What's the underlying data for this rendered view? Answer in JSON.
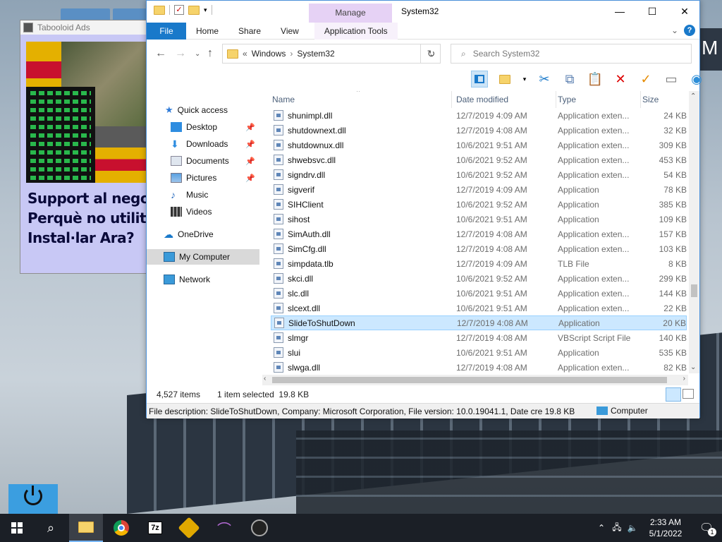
{
  "ads": {
    "title": "Tabooloid Ads",
    "lines": [
      "Support al negoci",
      "Perquè no utilitza",
      "Instal·lar Ara?"
    ]
  },
  "explorer": {
    "title": "System32",
    "manage_tab": "Manage",
    "ribbon_tabs": [
      "File",
      "Home",
      "Share",
      "View",
      "Application Tools"
    ],
    "address": {
      "prefix": "«",
      "crumbs": [
        "Windows",
        "System32"
      ]
    },
    "search_placeholder": "Search System32",
    "nav": {
      "quick_access": "Quick access",
      "items": [
        "Desktop",
        "Downloads",
        "Documents",
        "Pictures",
        "Music",
        "Videos"
      ],
      "onedrive": "OneDrive",
      "my_computer": "My Computer",
      "network": "Network"
    },
    "columns": [
      "Name",
      "Date modified",
      "Type",
      "Size"
    ],
    "files": [
      {
        "name": "shunimpl.dll",
        "date": "12/7/2019 4:09 AM",
        "type": "Application exten...",
        "size": "24 KB"
      },
      {
        "name": "shutdownext.dll",
        "date": "12/7/2019 4:08 AM",
        "type": "Application exten...",
        "size": "32 KB"
      },
      {
        "name": "shutdownux.dll",
        "date": "10/6/2021 9:51 AM",
        "type": "Application exten...",
        "size": "309 KB"
      },
      {
        "name": "shwebsvc.dll",
        "date": "10/6/2021 9:52 AM",
        "type": "Application exten...",
        "size": "453 KB"
      },
      {
        "name": "signdrv.dll",
        "date": "10/6/2021 9:52 AM",
        "type": "Application exten...",
        "size": "54 KB"
      },
      {
        "name": "sigverif",
        "date": "12/7/2019 4:09 AM",
        "type": "Application",
        "size": "78 KB"
      },
      {
        "name": "SIHClient",
        "date": "10/6/2021 9:52 AM",
        "type": "Application",
        "size": "385 KB"
      },
      {
        "name": "sihost",
        "date": "10/6/2021 9:51 AM",
        "type": "Application",
        "size": "109 KB"
      },
      {
        "name": "SimAuth.dll",
        "date": "12/7/2019 4:08 AM",
        "type": "Application exten...",
        "size": "157 KB"
      },
      {
        "name": "SimCfg.dll",
        "date": "12/7/2019 4:08 AM",
        "type": "Application exten...",
        "size": "103 KB"
      },
      {
        "name": "simpdata.tlb",
        "date": "12/7/2019 4:09 AM",
        "type": "TLB File",
        "size": "8 KB"
      },
      {
        "name": "skci.dll",
        "date": "10/6/2021 9:52 AM",
        "type": "Application exten...",
        "size": "299 KB"
      },
      {
        "name": "slc.dll",
        "date": "10/6/2021 9:51 AM",
        "type": "Application exten...",
        "size": "144 KB"
      },
      {
        "name": "slcext.dll",
        "date": "10/6/2021 9:51 AM",
        "type": "Application exten...",
        "size": "22 KB"
      },
      {
        "name": "SlideToShutDown",
        "date": "12/7/2019 4:08 AM",
        "type": "Application",
        "size": "20 KB"
      },
      {
        "name": "slmgr",
        "date": "12/7/2019 4:08 AM",
        "type": "VBScript Script File",
        "size": "140 KB"
      },
      {
        "name": "slui",
        "date": "10/6/2021 9:51 AM",
        "type": "Application",
        "size": "535 KB"
      },
      {
        "name": "slwga.dll",
        "date": "12/7/2019 4:08 AM",
        "type": "Application exten...",
        "size": "82 KB"
      }
    ],
    "selected_file": "SlideToShutDown",
    "status": {
      "items": "4,527 items",
      "selected": "1 item selected  19.8 KB"
    },
    "info": {
      "description": "File description: SlideToShutDown, Company: Microsoft Corporation, File version: 10.0.19041.1, Date cre 19.8 KB",
      "location": "Computer"
    }
  },
  "taskbar": {
    "time": "2:33 AM",
    "date": "5/1/2022",
    "apps": [
      "file-explorer",
      "chrome",
      "7zip",
      "keepass",
      "kali",
      "linux-app"
    ],
    "app_7zip_label": "7z",
    "notification_count": "1"
  }
}
